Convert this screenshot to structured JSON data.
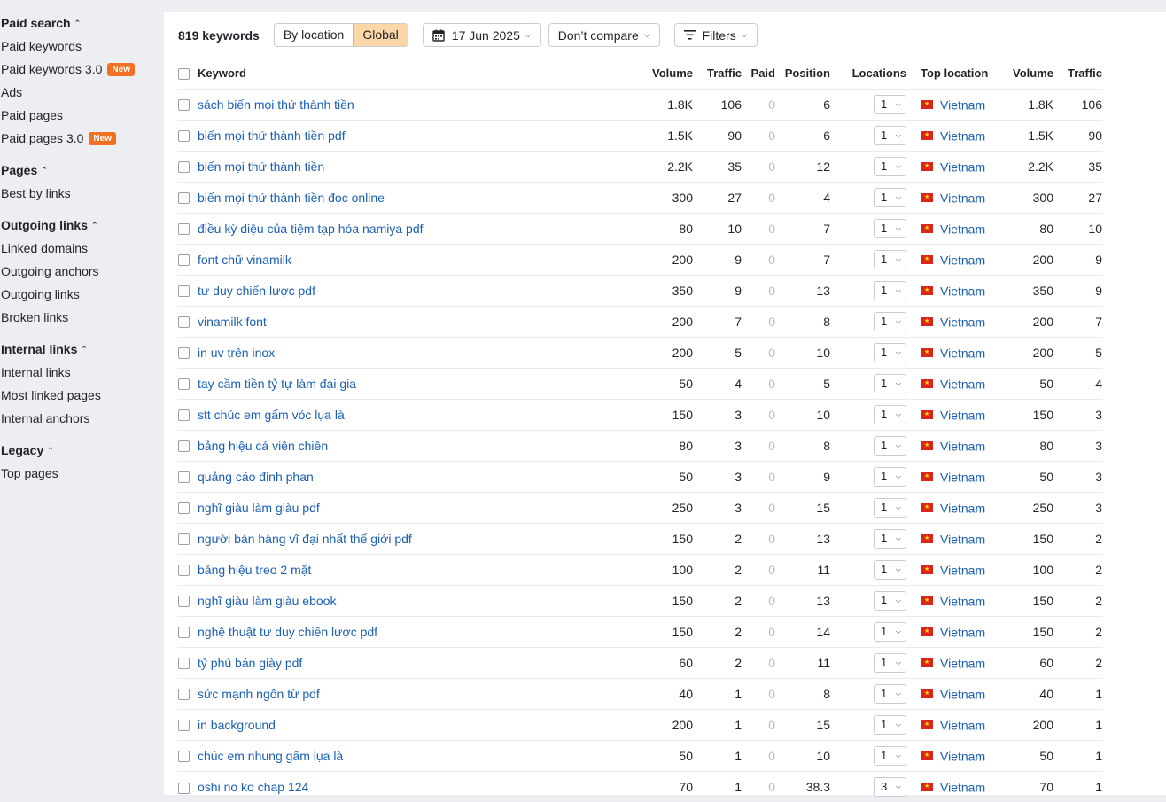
{
  "sidebar": {
    "groups": [
      {
        "title": "Paid search",
        "items": [
          {
            "label": "Paid keywords",
            "badge": ""
          },
          {
            "label": "Paid keywords 3.0",
            "badge": "New"
          },
          {
            "label": "Ads",
            "badge": ""
          },
          {
            "label": "Paid pages",
            "badge": ""
          },
          {
            "label": "Paid pages 3.0",
            "badge": "New"
          }
        ]
      },
      {
        "title": "Pages",
        "items": [
          {
            "label": "Best by links",
            "badge": ""
          }
        ]
      },
      {
        "title": "Outgoing links",
        "items": [
          {
            "label": "Linked domains",
            "badge": ""
          },
          {
            "label": "Outgoing anchors",
            "badge": ""
          },
          {
            "label": "Outgoing links",
            "badge": ""
          },
          {
            "label": "Broken links",
            "badge": ""
          }
        ]
      },
      {
        "title": "Internal links",
        "items": [
          {
            "label": "Internal links",
            "badge": ""
          },
          {
            "label": "Most linked pages",
            "badge": ""
          },
          {
            "label": "Internal anchors",
            "badge": ""
          }
        ]
      },
      {
        "title": "Legacy",
        "items": [
          {
            "label": "Top pages",
            "badge": ""
          }
        ]
      }
    ],
    "badge_color": "#f36f21"
  },
  "toolbar": {
    "keyword_count": "819 keywords",
    "by_location_label": "By location",
    "global_label": "Global",
    "date_label": "17 Jun 2025",
    "compare_label": "Don’t compare",
    "filters_label": "Filters"
  },
  "table": {
    "headers": {
      "keyword": "Keyword",
      "volume": "Volume",
      "traffic": "Traffic",
      "paid": "Paid",
      "position": "Position",
      "locations": "Locations",
      "top_location": "Top location",
      "volume2": "Volume",
      "traffic2": "Traffic"
    },
    "rows": [
      {
        "keyword": "sách biến mọi thứ thành tiền",
        "volume": "1.8K",
        "traffic": "106",
        "paid": "0",
        "position": "6",
        "locations": "1",
        "country": "Vietnam",
        "volume2": "1.8K",
        "traffic2": "106"
      },
      {
        "keyword": "biến mọi thứ thành tiền pdf",
        "volume": "1.5K",
        "traffic": "90",
        "paid": "0",
        "position": "6",
        "locations": "1",
        "country": "Vietnam",
        "volume2": "1.5K",
        "traffic2": "90"
      },
      {
        "keyword": "biến mọi thứ thành tiền",
        "volume": "2.2K",
        "traffic": "35",
        "paid": "0",
        "position": "12",
        "locations": "1",
        "country": "Vietnam",
        "volume2": "2.2K",
        "traffic2": "35"
      },
      {
        "keyword": "biến mọi thứ thành tiền đọc online",
        "volume": "300",
        "traffic": "27",
        "paid": "0",
        "position": "4",
        "locations": "1",
        "country": "Vietnam",
        "volume2": "300",
        "traffic2": "27"
      },
      {
        "keyword": "điều kỳ diệu của tiệm tạp hóa namiya pdf",
        "volume": "80",
        "traffic": "10",
        "paid": "0",
        "position": "7",
        "locations": "1",
        "country": "Vietnam",
        "volume2": "80",
        "traffic2": "10"
      },
      {
        "keyword": "font chữ vinamilk",
        "volume": "200",
        "traffic": "9",
        "paid": "0",
        "position": "7",
        "locations": "1",
        "country": "Vietnam",
        "volume2": "200",
        "traffic2": "9"
      },
      {
        "keyword": "tư duy chiến lược pdf",
        "volume": "350",
        "traffic": "9",
        "paid": "0",
        "position": "13",
        "locations": "1",
        "country": "Vietnam",
        "volume2": "350",
        "traffic2": "9"
      },
      {
        "keyword": "vinamilk font",
        "volume": "200",
        "traffic": "7",
        "paid": "0",
        "position": "8",
        "locations": "1",
        "country": "Vietnam",
        "volume2": "200",
        "traffic2": "7"
      },
      {
        "keyword": "in uv trên inox",
        "volume": "200",
        "traffic": "5",
        "paid": "0",
        "position": "10",
        "locations": "1",
        "country": "Vietnam",
        "volume2": "200",
        "traffic2": "5"
      },
      {
        "keyword": "tay cầm tiền tỷ tự làm đại gia",
        "volume": "50",
        "traffic": "4",
        "paid": "0",
        "position": "5",
        "locations": "1",
        "country": "Vietnam",
        "volume2": "50",
        "traffic2": "4"
      },
      {
        "keyword": "stt chúc em gấm vóc lụa là",
        "volume": "150",
        "traffic": "3",
        "paid": "0",
        "position": "10",
        "locations": "1",
        "country": "Vietnam",
        "volume2": "150",
        "traffic2": "3"
      },
      {
        "keyword": "bảng hiệu cá viên chiên",
        "volume": "80",
        "traffic": "3",
        "paid": "0",
        "position": "8",
        "locations": "1",
        "country": "Vietnam",
        "volume2": "80",
        "traffic2": "3"
      },
      {
        "keyword": "quảng cáo đinh phan",
        "volume": "50",
        "traffic": "3",
        "paid": "0",
        "position": "9",
        "locations": "1",
        "country": "Vietnam",
        "volume2": "50",
        "traffic2": "3"
      },
      {
        "keyword": "nghĩ giàu làm giàu pdf",
        "volume": "250",
        "traffic": "3",
        "paid": "0",
        "position": "15",
        "locations": "1",
        "country": "Vietnam",
        "volume2": "250",
        "traffic2": "3"
      },
      {
        "keyword": "người bán hàng vĩ đại nhất thế giới pdf",
        "volume": "150",
        "traffic": "2",
        "paid": "0",
        "position": "13",
        "locations": "1",
        "country": "Vietnam",
        "volume2": "150",
        "traffic2": "2"
      },
      {
        "keyword": "bảng hiệu treo 2 mặt",
        "volume": "100",
        "traffic": "2",
        "paid": "0",
        "position": "11",
        "locations": "1",
        "country": "Vietnam",
        "volume2": "100",
        "traffic2": "2"
      },
      {
        "keyword": "nghĩ giàu làm giàu ebook",
        "volume": "150",
        "traffic": "2",
        "paid": "0",
        "position": "13",
        "locations": "1",
        "country": "Vietnam",
        "volume2": "150",
        "traffic2": "2"
      },
      {
        "keyword": "nghệ thuật tư duy chiến lược pdf",
        "volume": "150",
        "traffic": "2",
        "paid": "0",
        "position": "14",
        "locations": "1",
        "country": "Vietnam",
        "volume2": "150",
        "traffic2": "2"
      },
      {
        "keyword": "tỷ phú bán giày pdf",
        "volume": "60",
        "traffic": "2",
        "paid": "0",
        "position": "11",
        "locations": "1",
        "country": "Vietnam",
        "volume2": "60",
        "traffic2": "2"
      },
      {
        "keyword": "sức mạnh ngôn từ pdf",
        "volume": "40",
        "traffic": "1",
        "paid": "0",
        "position": "8",
        "locations": "1",
        "country": "Vietnam",
        "volume2": "40",
        "traffic2": "1"
      },
      {
        "keyword": "in background",
        "volume": "200",
        "traffic": "1",
        "paid": "0",
        "position": "15",
        "locations": "1",
        "country": "Vietnam",
        "volume2": "200",
        "traffic2": "1"
      },
      {
        "keyword": "chúc em nhung gấm lụa là",
        "volume": "50",
        "traffic": "1",
        "paid": "0",
        "position": "10",
        "locations": "1",
        "country": "Vietnam",
        "volume2": "50",
        "traffic2": "1"
      },
      {
        "keyword": "oshi no ko chap 124",
        "volume": "70",
        "traffic": "1",
        "paid": "0",
        "position": "38.3",
        "locations": "3",
        "country": "Vietnam",
        "volume2": "70",
        "traffic2": "1"
      }
    ]
  }
}
